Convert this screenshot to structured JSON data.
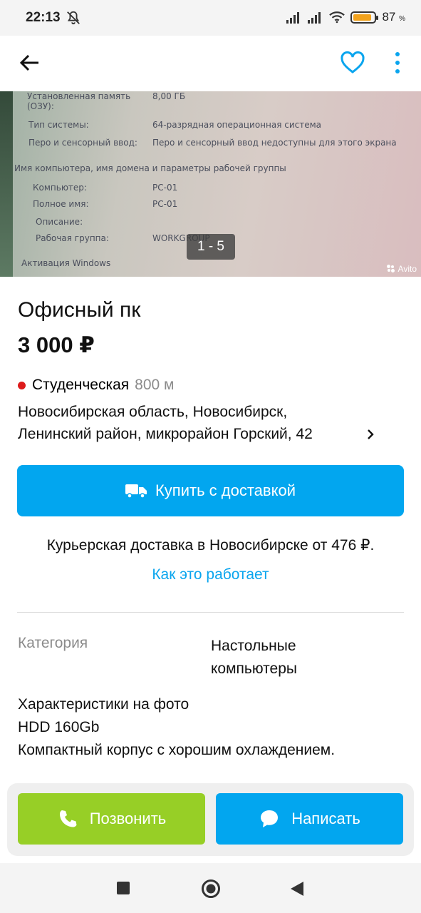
{
  "status_bar": {
    "time": "22:13",
    "battery_percent": "87",
    "battery_sign": "%",
    "battery_level": 0.87
  },
  "app_bar": {
    "back_icon": "arrow-left-icon",
    "favorite_icon": "heart-icon",
    "menu_icon": "more-vertical-icon",
    "accent_color": "#0AA5EE"
  },
  "gallery": {
    "counter": "1 - 5",
    "watermark": "Avito",
    "photo_text": [
      [
        "Установленная память",
        "8,00 ГБ"
      ],
      [
        "(ОЗУ):",
        ""
      ],
      [
        "Тип системы:",
        "64-разрядная операционная система"
      ],
      [
        "Перо и сенсорный ввод:",
        "Перо и сенсорный ввод недоступны для этого экрана"
      ],
      [
        "Имя компьютера, имя домена и параметры рабочей группы",
        ""
      ],
      [
        "Компьютер:",
        "PC-01"
      ],
      [
        "Полное имя:",
        "PC-01"
      ],
      [
        "Описание:",
        ""
      ],
      [
        "Рабочая группа:",
        "WORKGROUP"
      ],
      [
        "Активация Windows",
        ""
      ]
    ]
  },
  "listing": {
    "title": "Офисный пк",
    "price": "3 000 ₽",
    "metro_station": "Студенческая",
    "metro_distance": "800 м",
    "metro_color": "#DD1B1B",
    "address_line1": "Новосибирская область, Новосибирск,",
    "address_line2": "Ленинский район, микрорайон Горский, 42"
  },
  "delivery": {
    "button_label": "Купить с доставкой",
    "button_color": "#02A6EF",
    "info": "Курьерская доставка в Новосибирске от 476 ₽.",
    "how_it_works": "Как это работает"
  },
  "params": {
    "category_label": "Категория",
    "category_value_line1": "Настольные",
    "category_value_line2": "компьютеры"
  },
  "description": {
    "lines": [
      "Характеристики на фото",
      "HDD 160Gb",
      "Компактный корпус с хорошим охлаждением."
    ]
  },
  "actions": {
    "call_label": "Позвонить",
    "call_color": "#97CF26",
    "message_label": "Написать",
    "message_color": "#02A6EF"
  },
  "nav_bar": {
    "recents_icon": "square-icon",
    "home_icon": "circle-home-icon",
    "back_icon": "triangle-back-icon"
  }
}
